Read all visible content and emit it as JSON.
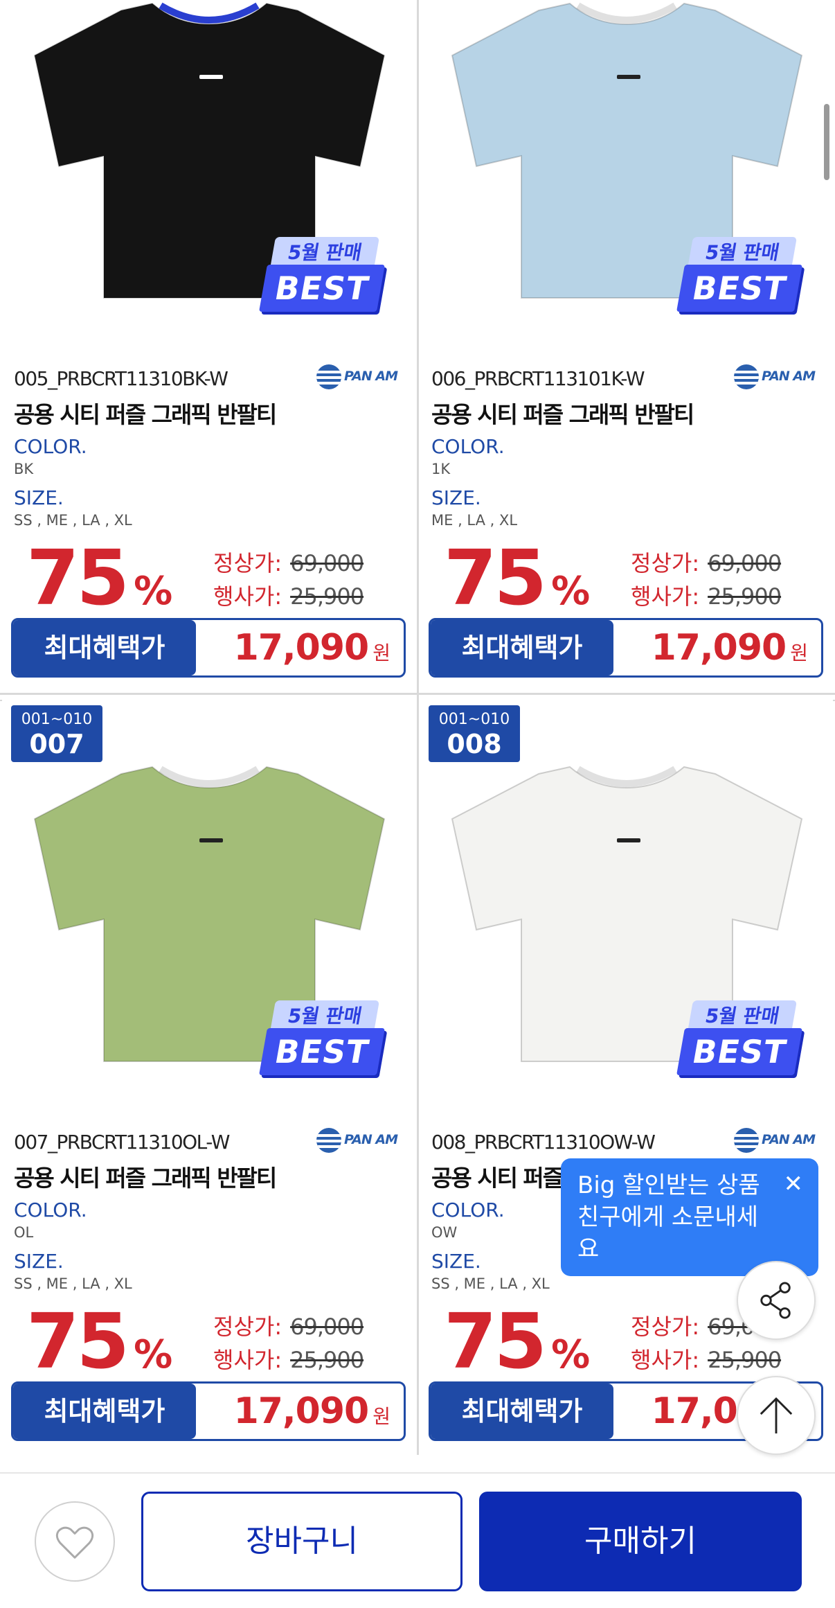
{
  "colors": {
    "accent": "#1f4aa6",
    "sale_red": "#d2262e",
    "cta": "#0d2bb3",
    "tooltip": "#2f7df6"
  },
  "products": [
    {
      "rank_range": "",
      "rank_number": "",
      "shirt_color": "#141414",
      "best_month": "5월 판매",
      "best_word": "BEST",
      "sku": "005_PRBCRT11310BK-W",
      "brand": "PAN AM",
      "name": "공용 시티 퍼즐 그래픽 반팔티",
      "color_label": "COLOR.",
      "color_value": "BK",
      "size_label": "SIZE.",
      "size_value": "SS , ME , LA , XL",
      "discount_number": "75",
      "discount_unit": "%",
      "regular_label": "정상가:",
      "regular_price": "69,000",
      "event_label": "행사가:",
      "event_price": "25,900",
      "benefit_label": "최대혜택가",
      "benefit_price": "17,090",
      "benefit_unit": "원"
    },
    {
      "rank_range": "",
      "rank_number": "",
      "shirt_color": "#b7d3e6",
      "best_month": "5월 판매",
      "best_word": "BEST",
      "sku": "006_PRBCRT113101K-W",
      "brand": "PAN AM",
      "name": "공용 시티 퍼즐 그래픽 반팔티",
      "color_label": "COLOR.",
      "color_value": "1K",
      "size_label": "SIZE.",
      "size_value": "ME , LA , XL",
      "discount_number": "75",
      "discount_unit": "%",
      "regular_label": "정상가:",
      "regular_price": "69,000",
      "event_label": "행사가:",
      "event_price": "25,900",
      "benefit_label": "최대혜택가",
      "benefit_price": "17,090",
      "benefit_unit": "원"
    },
    {
      "rank_range": "001~010",
      "rank_number": "007",
      "shirt_color": "#a3bd78",
      "best_month": "5월 판매",
      "best_word": "BEST",
      "sku": "007_PRBCRT11310OL-W",
      "brand": "PAN AM",
      "name": "공용 시티 퍼즐 그래픽 반팔티",
      "color_label": "COLOR.",
      "color_value": "OL",
      "size_label": "SIZE.",
      "size_value": "SS , ME , LA , XL",
      "discount_number": "75",
      "discount_unit": "%",
      "regular_label": "정상가:",
      "regular_price": "69,000",
      "event_label": "행사가:",
      "event_price": "25,900",
      "benefit_label": "최대혜택가",
      "benefit_price": "17,090",
      "benefit_unit": "원"
    },
    {
      "rank_range": "001~010",
      "rank_number": "008",
      "shirt_color": "#f3f3f1",
      "best_month": "5월 판매",
      "best_word": "BEST",
      "sku": "008_PRBCRT11310OW-W",
      "brand": "PAN AM",
      "name": "공용 시티 퍼즐 그래픽 반팔티",
      "color_label": "COLOR.",
      "color_value": "OW",
      "size_label": "SIZE.",
      "size_value": "SS , ME , LA , XL",
      "discount_number": "75",
      "discount_unit": "%",
      "regular_label": "정상가:",
      "regular_price": "69,000",
      "event_label": "행사가:",
      "event_price": "25,900",
      "benefit_label": "최대혜택가",
      "benefit_price": "17,090",
      "benefit_unit": "원"
    }
  ],
  "share_tooltip": {
    "text": "Big 할인받는 상품 친구에게 소문내세요",
    "close_icon": "close-icon"
  },
  "floating": {
    "share_icon": "share-icon",
    "top_icon": "arrow-up-icon"
  },
  "bottom_bar": {
    "wishlist_icon": "heart-icon",
    "cart_label": "장바구니",
    "buy_label": "구매하기"
  }
}
